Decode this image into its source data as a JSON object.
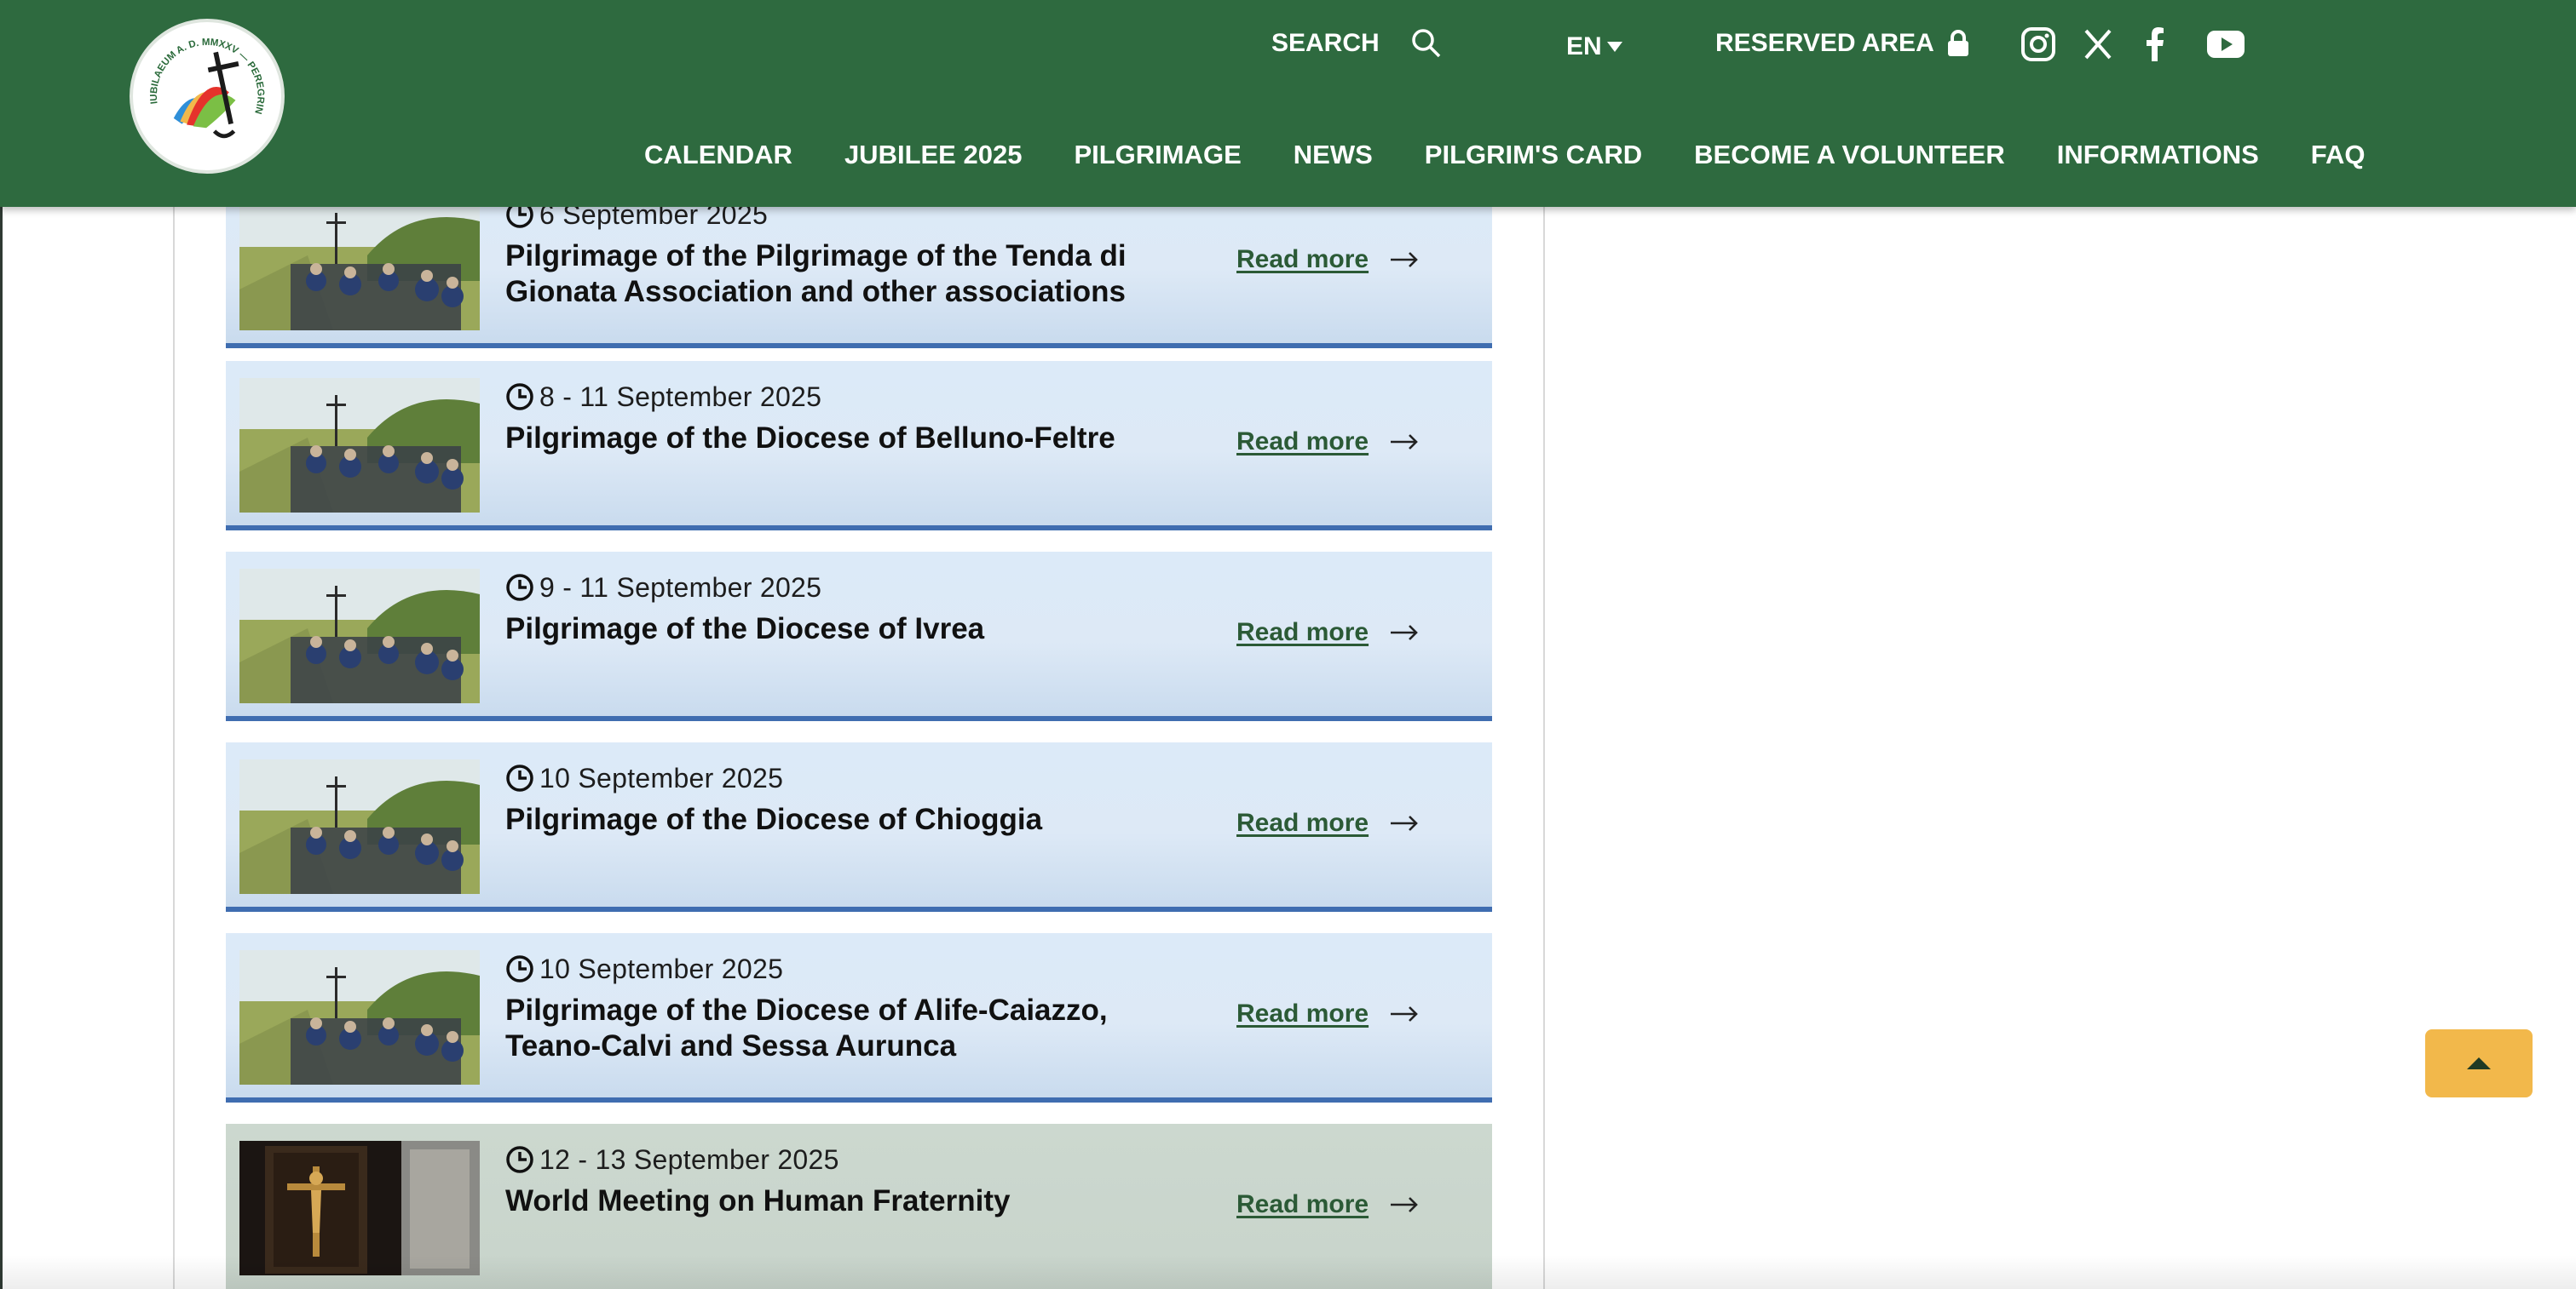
{
  "header": {
    "logo_alt": "IUBILAEUM A. D. MMXXV — PEREGRINANTES IN SPEM",
    "search_label": "SEARCH",
    "language": "EN",
    "reserved_area_label": "RESERVED AREA",
    "social": [
      "instagram-icon",
      "x-icon",
      "facebook-icon",
      "youtube-icon"
    ],
    "nav": [
      "CALENDAR",
      "JUBILEE 2025",
      "PILGRIMAGE",
      "NEWS",
      "PILGRIM'S CARD",
      "BECOME A VOLUNTEER",
      "INFORMATIONS",
      "FAQ"
    ],
    "colors": {
      "header_bg": "#2e6a3f",
      "card_bg": "#dceaf8",
      "card_border": "#3f6db0",
      "link": "#2b5a36",
      "to_top": "#f2b84b"
    }
  },
  "events": [
    {
      "date": "6 September 2025",
      "title": "Pilgrimage of the Pilgrimage of the Tenda di Gionata Association and other associations",
      "read_more": "Read more",
      "image": "pilgrims-walking"
    },
    {
      "date": "8 - 11 September 2025",
      "title": "Pilgrimage of the Diocese of Belluno-Feltre",
      "read_more": "Read more",
      "image": "pilgrims-walking"
    },
    {
      "date": "9 - 11 September 2025",
      "title": "Pilgrimage of the Diocese of Ivrea",
      "read_more": "Read more",
      "image": "pilgrims-walking"
    },
    {
      "date": "10 September 2025",
      "title": "Pilgrimage of the Diocese of Chioggia",
      "read_more": "Read more",
      "image": "pilgrims-walking"
    },
    {
      "date": "10 September 2025",
      "title": "Pilgrimage of the Diocese of Alife-Caiazzo, Teano-Calvi and Sessa Aurunca",
      "read_more": "Read more",
      "image": "pilgrims-walking"
    },
    {
      "date": "12 - 13 September 2025",
      "title": "World Meeting on Human Fraternity",
      "read_more": "Read more",
      "image": "crucifix-painting"
    }
  ]
}
